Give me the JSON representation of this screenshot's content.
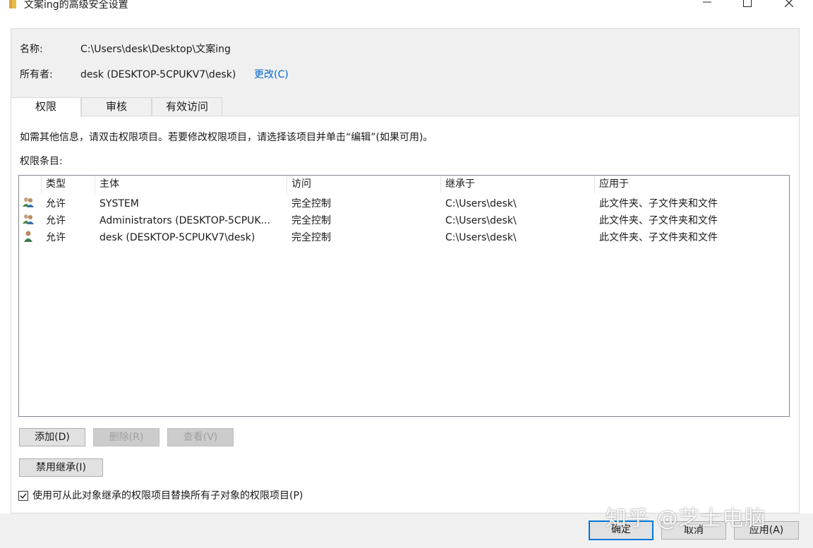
{
  "window": {
    "title": "文案ing的高级安全设置",
    "minimize_icon": "minimize-icon",
    "maximize_icon": "maximize-icon",
    "close_icon": "close-icon"
  },
  "info": {
    "name_label": "名称:",
    "name_value": "C:\\Users\\desk\\Desktop\\文案ing",
    "owner_label": "所有者:",
    "owner_value": "desk (DESKTOP-5CPUKV7\\desk)",
    "change_link": "更改(C)"
  },
  "tabs": [
    {
      "label": "权限",
      "active": true
    },
    {
      "label": "审核",
      "active": false
    },
    {
      "label": "有效访问",
      "active": false
    }
  ],
  "permissions": {
    "hint": "如需其他信息，请双击权限项目。若要修改权限项目，请选择该项目并单击“编辑”(如果可用)。",
    "entries_label": "权限条目:",
    "columns": [
      "类型",
      "主体",
      "访问",
      "继承于",
      "应用于"
    ],
    "rows": [
      {
        "icon": "group-users-icon",
        "type": "允许",
        "principal": "SYSTEM",
        "access": "完全控制",
        "inherited_from": "C:\\Users\\desk\\",
        "applies_to": "此文件夹、子文件夹和文件"
      },
      {
        "icon": "group-users-icon",
        "type": "允许",
        "principal": "Administrators (DESKTOP-5CPUK...",
        "access": "完全控制",
        "inherited_from": "C:\\Users\\desk\\",
        "applies_to": "此文件夹、子文件夹和文件"
      },
      {
        "icon": "user-icon",
        "type": "允许",
        "principal": "desk (DESKTOP-5CPUKV7\\desk)",
        "access": "完全控制",
        "inherited_from": "C:\\Users\\desk\\",
        "applies_to": "此文件夹、子文件夹和文件"
      }
    ],
    "add_button": "添加(D)",
    "remove_button": "删除(R)",
    "view_button": "查看(V)",
    "disable_inheritance_button": "禁用继承(I)",
    "replace_checkbox_label": "使用可从此对象继承的权限项目替换所有子对象的权限项目(P)",
    "replace_checkbox_checked": true
  },
  "footer": {
    "ok_button": "确定",
    "cancel_button": "取消",
    "apply_button": "应用(A)"
  },
  "watermark": "知乎 @芝士电脑",
  "colors": {
    "link": "#0066cc",
    "primary_border": "#0078d7",
    "panel_bg": "#f0f0f0"
  }
}
